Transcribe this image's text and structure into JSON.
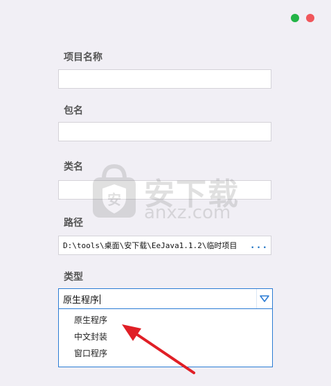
{
  "window_controls": {
    "maximize_color": "#23b447",
    "close_color": "#f0565b"
  },
  "form": {
    "project_name": {
      "label": "项目名称",
      "value": ""
    },
    "package_name": {
      "label": "包名",
      "value": ""
    },
    "class_name": {
      "label": "类名",
      "value": ""
    },
    "path": {
      "label": "路径",
      "value": "D:\\tools\\桌面\\安下载\\EeJava1.1.2\\临时项目",
      "browse_label": "..."
    },
    "type": {
      "label": "类型",
      "selected": "原生程序",
      "options": [
        "原生程序",
        "中文封装",
        "窗口程序"
      ]
    }
  },
  "watermark": {
    "icon": "shield-bag-logo",
    "title": "安下载",
    "url": "anxz.com"
  },
  "colors": {
    "accent": "#2a7bd4",
    "annotation_arrow": "#e01f26"
  }
}
